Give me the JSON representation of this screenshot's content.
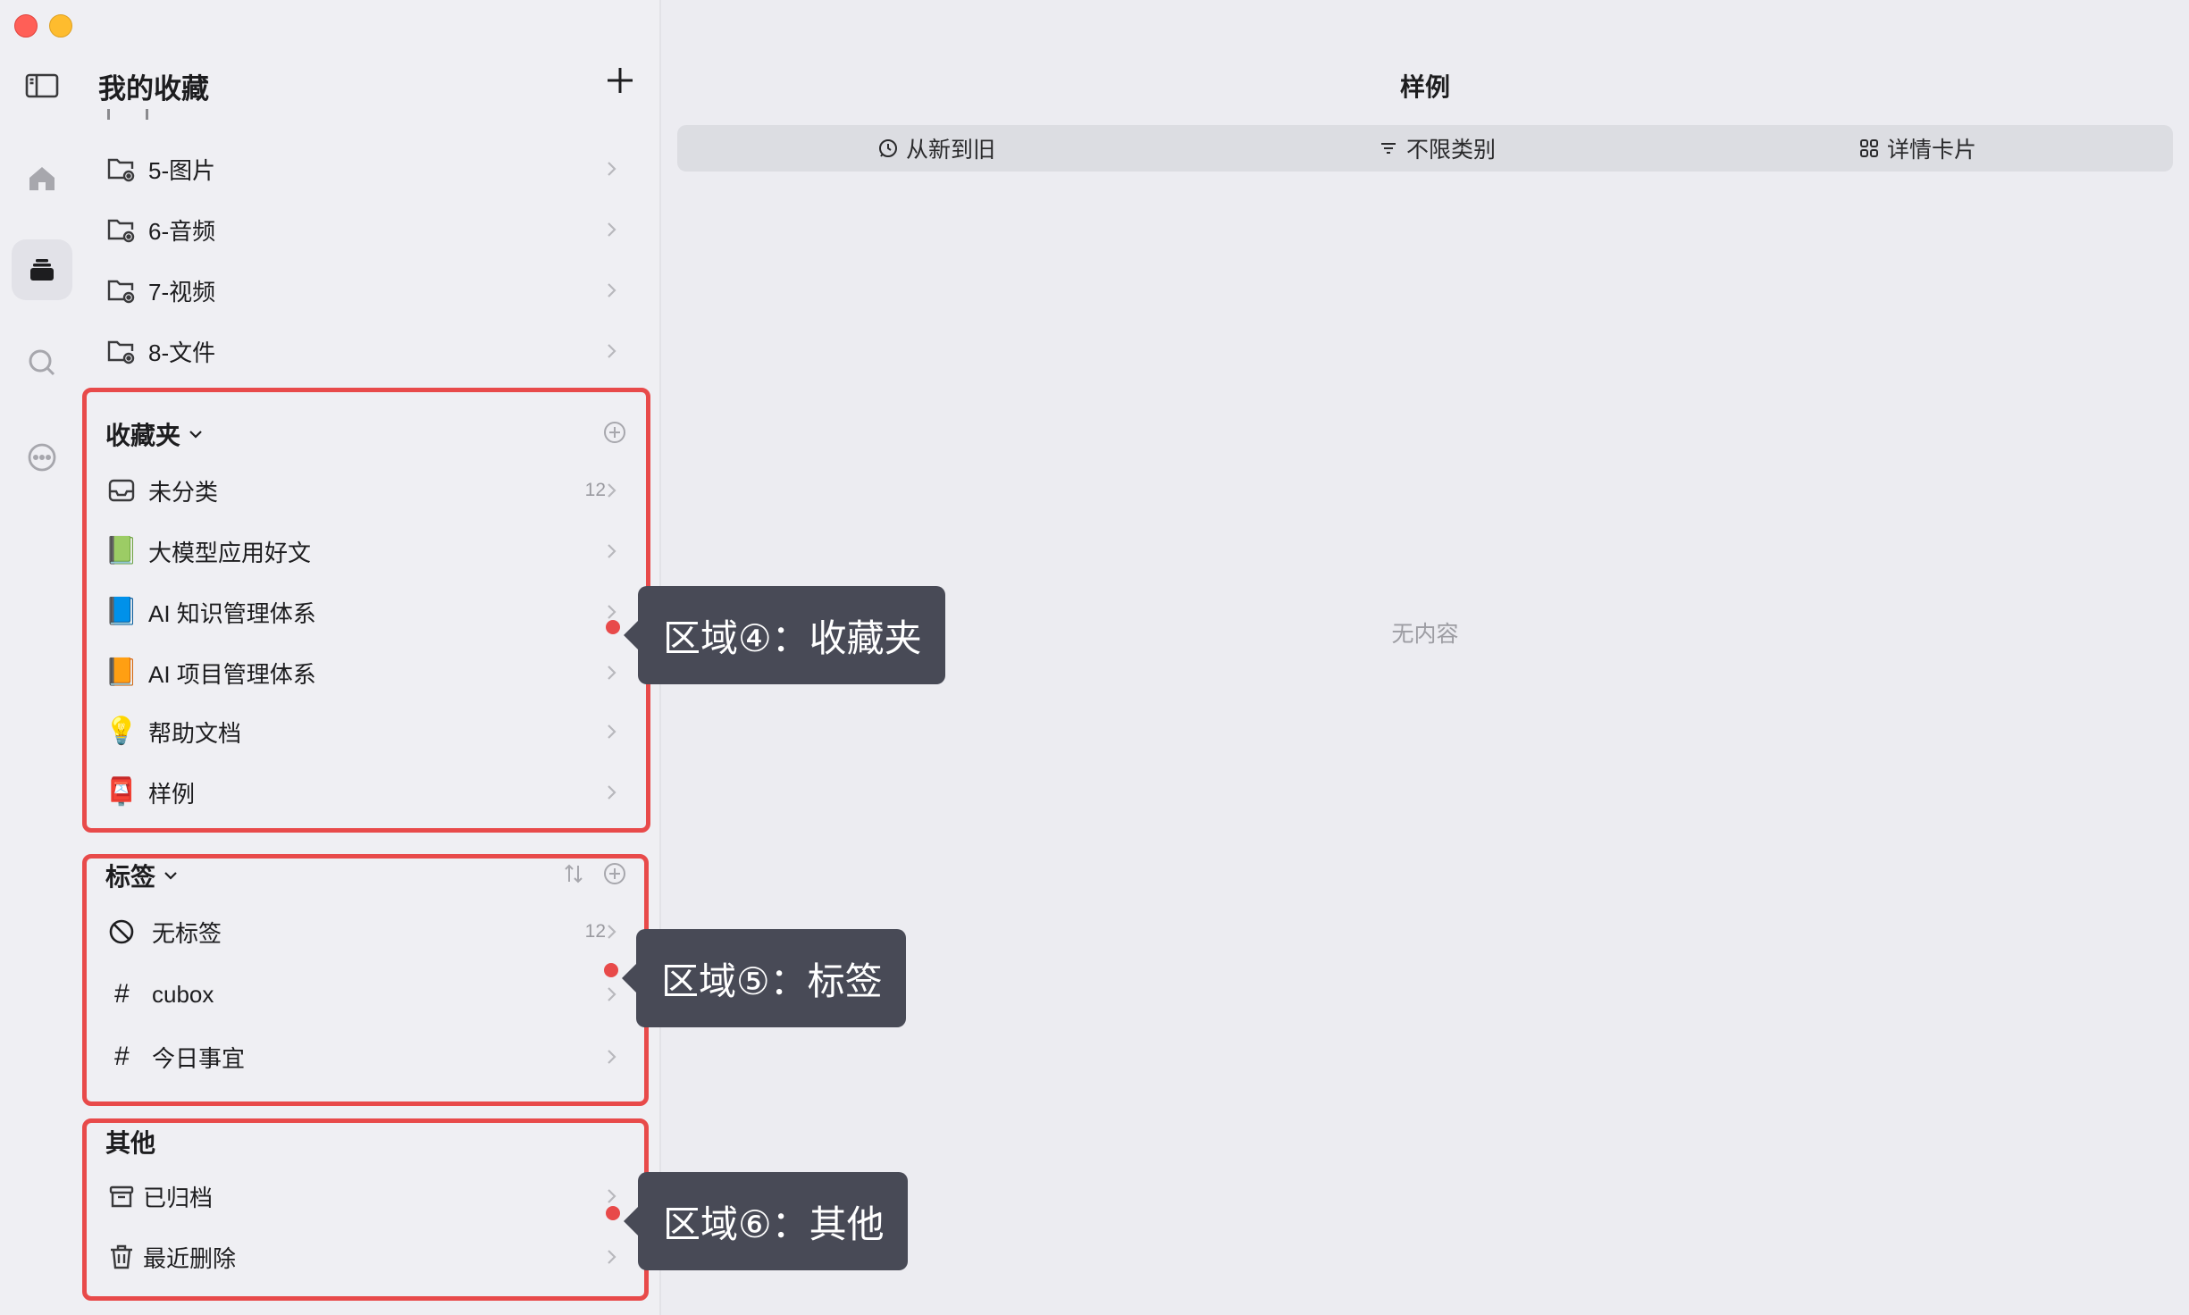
{
  "sidebar": {
    "title": "我的收藏",
    "top_items": [
      {
        "label": "5-图片"
      },
      {
        "label": "6-音频"
      },
      {
        "label": "7-视频"
      },
      {
        "label": "8-文件"
      }
    ],
    "collections": {
      "header": "收藏夹",
      "items": [
        {
          "label": "未分类",
          "count": "12",
          "icon": "inbox-icon"
        },
        {
          "label": "大模型应用好文",
          "icon": "green-book-icon",
          "glyph": "📗"
        },
        {
          "label": "AI 知识管理体系",
          "icon": "blue-book-icon",
          "glyph": "📘"
        },
        {
          "label": "AI 项目管理体系",
          "icon": "orange-book-icon",
          "glyph": "📙"
        },
        {
          "label": "帮助文档",
          "icon": "light-bulb-icon",
          "glyph": "💡"
        },
        {
          "label": "样例",
          "icon": "postbox-icon",
          "glyph": "📮"
        }
      ]
    },
    "tags": {
      "header": "标签",
      "items": [
        {
          "label": "无标签",
          "count": "12",
          "icon": "no-tag-icon"
        },
        {
          "label": "cubox",
          "icon": "hash-icon",
          "glyph": "#"
        },
        {
          "label": "今日事宜",
          "icon": "hash-icon",
          "glyph": "#"
        }
      ]
    },
    "other": {
      "header": "其他",
      "items": [
        {
          "label": "已归档",
          "icon": "archive-icon"
        },
        {
          "label": "最近删除",
          "icon": "trash-icon"
        }
      ]
    }
  },
  "main": {
    "title": "样例",
    "toolbar": {
      "sort_label": "从新到旧",
      "filter_label": "不限类别",
      "view_label": "详情卡片"
    },
    "empty_text": "无内容"
  },
  "callouts": {
    "area4": "区域④：收藏夹",
    "area5": "区域⑤：标签",
    "area6": "区域⑥：其他"
  },
  "colors": {
    "highlight": "#e84a4a",
    "callout_bg": "#484a56",
    "window_bg": "#ececf1"
  }
}
